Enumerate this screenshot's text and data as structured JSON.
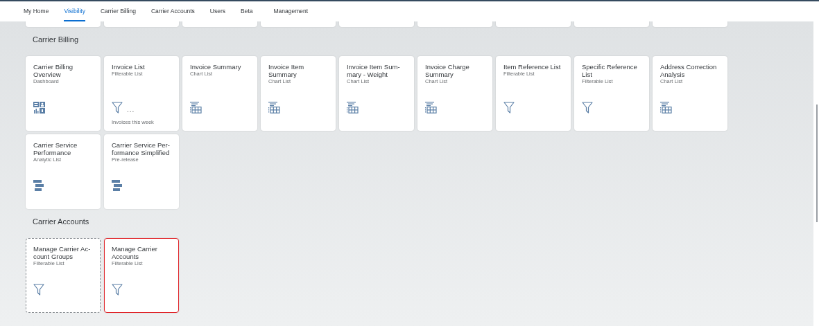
{
  "tabs": [
    {
      "label": "My Home",
      "selected": false
    },
    {
      "label": "Visibility",
      "selected": true
    },
    {
      "label": "Carrier Billing",
      "selected": false
    },
    {
      "label": "Carrier Accounts",
      "selected": false
    },
    {
      "label": "Users",
      "selected": false
    },
    {
      "label": "Beta",
      "selected": false
    },
    {
      "label": "Management",
      "selected": false
    }
  ],
  "sections": [
    {
      "title": "Carrier Billing",
      "tiles": [
        {
          "title": "Carrier Billing Overview",
          "subtitle": "Dashboard",
          "kind": "dashboard",
          "dashed": false,
          "highlighted": false
        },
        {
          "title": "Invoice List",
          "subtitle": "Filterable List",
          "kind": "filter",
          "indicator": "...",
          "footer": "Invoices this week",
          "dashed": false,
          "highlighted": false
        },
        {
          "title": "Invoice Summary",
          "subtitle": "Chart List",
          "kind": "chart",
          "dashed": false,
          "highlighted": false
        },
        {
          "title": "Invoice Item Summary",
          "subtitle": "Chart List",
          "kind": "chart",
          "dashed": false,
          "highlighted": false
        },
        {
          "title": "Invoice Item Sum-mary - Weight",
          "subtitle": "Chart List",
          "kind": "chart",
          "dashed": false,
          "highlighted": false
        },
        {
          "title": "Invoice Charge Summary",
          "subtitle": "Chart List",
          "kind": "chart",
          "dashed": false,
          "highlighted": false
        },
        {
          "title": "Item Reference List",
          "subtitle": "Filterable List",
          "kind": "filter",
          "dashed": false,
          "highlighted": false
        },
        {
          "title": "Specific Reference List",
          "subtitle": "Filterable List",
          "kind": "filter",
          "dashed": false,
          "highlighted": false
        },
        {
          "title": "Address Correction Analysis",
          "subtitle": "Chart List",
          "kind": "chart",
          "dashed": false,
          "highlighted": false
        },
        {
          "title": "Carrier Service Performance",
          "subtitle": "Analytic List",
          "kind": "analytic",
          "dashed": false,
          "highlighted": false
        },
        {
          "title": "Carrier Service Per-formance Simplified",
          "subtitle": "Pre-release",
          "kind": "analytic",
          "dashed": false,
          "highlighted": false
        }
      ]
    },
    {
      "title": "Carrier Accounts",
      "tiles": [
        {
          "title": "Manage Carrier Ac-count Groups",
          "subtitle": "Filterable List",
          "kind": "filter",
          "dashed": true,
          "highlighted": false
        },
        {
          "title": "Manage Carrier Accounts",
          "subtitle": "Filterable List",
          "kind": "filter",
          "dashed": false,
          "highlighted": true
        }
      ]
    }
  ]
}
